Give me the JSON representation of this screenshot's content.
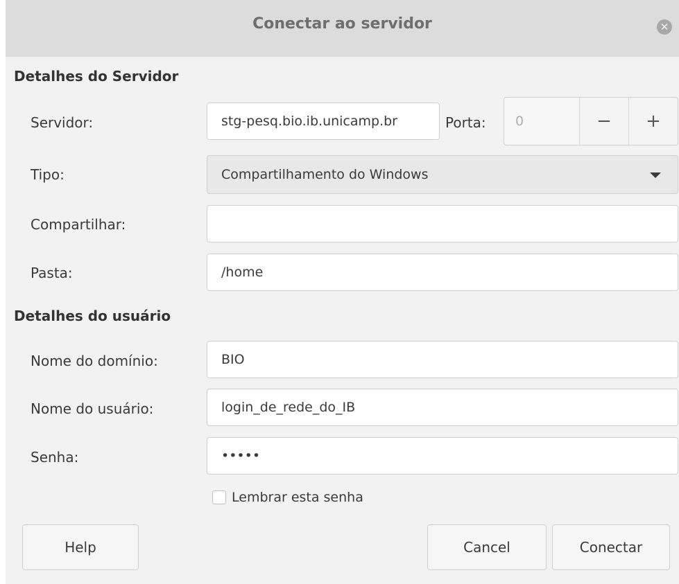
{
  "window": {
    "title": "Conectar ao servidor"
  },
  "server_section": {
    "heading": "Detalhes do Servidor",
    "server_label": "Servidor:",
    "server_value": "stg-pesq.bio.ib.unicamp.br",
    "port_label": "Porta:",
    "port_value": "0",
    "port_minus": "−",
    "port_plus": "+",
    "type_label": "Tipo:",
    "type_value": "Compartilhamento do Windows",
    "share_label": "Compartilhar:",
    "share_value": "",
    "folder_label": "Pasta:",
    "folder_value": "/home"
  },
  "user_section": {
    "heading": "Detalhes do usuário",
    "domain_label": "Nome do domínio:",
    "domain_value": "BIO",
    "username_label": "Nome do usuário:",
    "username_value": "login_de_rede_do_IB",
    "password_label": "Senha:",
    "password_value": "•••••",
    "remember_label": "Lembrar esta senha",
    "remember_checked": false
  },
  "buttons": {
    "help": "Help",
    "cancel": "Cancel",
    "connect": "Conectar"
  },
  "icons": {
    "close": "close-icon",
    "dropdown": "chevron-down-icon"
  }
}
